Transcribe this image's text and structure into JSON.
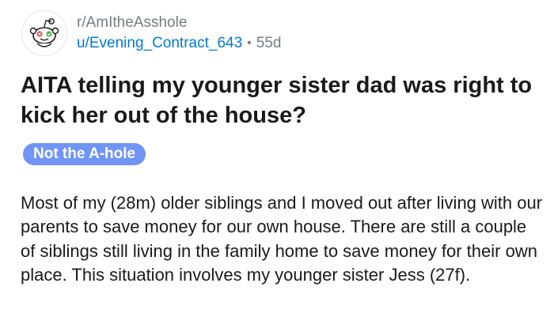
{
  "post": {
    "subreddit": "r/AmItheAsshole",
    "username": "u/Evening_Contract_643",
    "separator": "•",
    "age": "55d",
    "title": "AITA telling my younger sister dad was right to kick her out of the house?",
    "flair": "Not the A-hole",
    "body": "Most of my (28m) older siblings and I moved out after living with our parents to save money for our own house. There are still a couple of siblings still living in the family home to save money for their own place. This situation involves my younger sister Jess (27f)."
  },
  "icons": {
    "avatar": "subreddit-snoo-avatar-icon"
  },
  "colors": {
    "username": "#0079d3",
    "muted": "#787c7e",
    "flair_bg": "#7194f7"
  }
}
